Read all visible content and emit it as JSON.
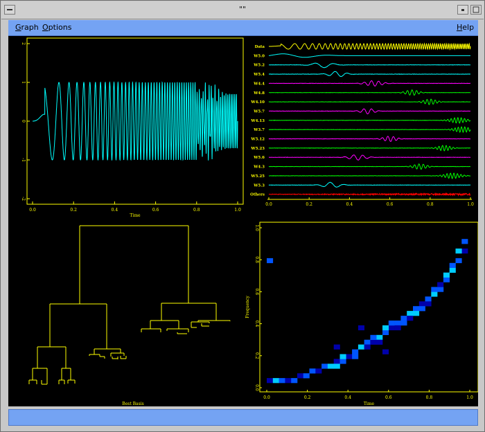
{
  "window": {
    "title": "\"\""
  },
  "menubar": {
    "items": [
      {
        "label": "Graph",
        "mnemonic": "G"
      },
      {
        "label": "Options",
        "mnemonic": "O"
      }
    ],
    "help": {
      "label": "Help",
      "mnemonic": "H"
    }
  },
  "colors": {
    "signal": "#00ffff",
    "axes_primary": "#ffff00",
    "magenta": "#ff00ff",
    "green": "#00ff00",
    "red": "#ff0000",
    "menubar": "#74a3f3"
  },
  "chart_data": [
    {
      "type": "line",
      "xlabel": "Time",
      "ylabel": "",
      "xlim": [
        0,
        1
      ],
      "ylim": [
        -2,
        2
      ],
      "x_ticks": [
        "0.0",
        "0.2",
        "0.4",
        "0.6",
        "0.8",
        "1.0"
      ],
      "y_ticks": [
        "-2",
        "-1",
        "0",
        "1",
        "2"
      ],
      "description_series": "chirp signal"
    },
    {
      "type": "line",
      "xlim": [
        0,
        1
      ],
      "x_ticks": [
        "0.0",
        "0.2",
        "0.4",
        "0.6",
        "0.8",
        "1.0"
      ],
      "rows": [
        {
          "label": "Data",
          "color": "#ffff00",
          "kind": "chirp"
        },
        {
          "label": "W5.0",
          "color": "#00ffff",
          "kind": "low",
          "center": 0.12,
          "width": 0.14,
          "freq": 4
        },
        {
          "label": "W5.2",
          "color": "#00ffff",
          "kind": "packet",
          "center": 0.27,
          "width": 0.06,
          "freq": 10
        },
        {
          "label": "W5.4",
          "color": "#00ffff",
          "kind": "packet",
          "center": 0.34,
          "width": 0.05,
          "freq": 16
        },
        {
          "label": "W4.4",
          "color": "#ff00ff",
          "kind": "packet",
          "center": 0.52,
          "width": 0.05,
          "freq": 28
        },
        {
          "label": "W4.8",
          "color": "#00ff00",
          "kind": "packet",
          "center": 0.71,
          "width": 0.04,
          "freq": 44
        },
        {
          "label": "W4.10",
          "color": "#00ff00",
          "kind": "packet",
          "center": 0.8,
          "width": 0.04,
          "freq": 50
        },
        {
          "label": "W5.7",
          "color": "#ff00ff",
          "kind": "packet",
          "center": 0.49,
          "width": 0.04,
          "freq": 26
        },
        {
          "label": "W4.13",
          "color": "#00ff00",
          "kind": "packet",
          "center": 0.94,
          "width": 0.05,
          "freq": 60
        },
        {
          "label": "W3.7",
          "color": "#00ff00",
          "kind": "packet",
          "center": 0.96,
          "width": 0.05,
          "freq": 62
        },
        {
          "label": "W5.12",
          "color": "#ff00ff",
          "kind": "packet",
          "center": 0.6,
          "width": 0.04,
          "freq": 36
        },
        {
          "label": "W5.23",
          "color": "#00ff00",
          "kind": "packet",
          "center": 0.87,
          "width": 0.04,
          "freq": 56
        },
        {
          "label": "W5.6",
          "color": "#ff00ff",
          "kind": "packet",
          "center": 0.44,
          "width": 0.05,
          "freq": 22
        },
        {
          "label": "W4.3",
          "color": "#00ff00",
          "kind": "packet",
          "center": 0.75,
          "width": 0.04,
          "freq": 46
        },
        {
          "label": "W5.25",
          "color": "#00ff00",
          "kind": "packet",
          "center": 0.91,
          "width": 0.05,
          "freq": 58
        },
        {
          "label": "W5.3",
          "color": "#00ffff",
          "kind": "packet",
          "center": 0.31,
          "width": 0.05,
          "freq": 14
        },
        {
          "label": "Others",
          "color": "#ff0000",
          "kind": "noise"
        }
      ]
    },
    {
      "type": "dendrogram",
      "xlabel": "Best Basis",
      "color": "#ffff00"
    },
    {
      "type": "heatmap",
      "xlabel": "Time",
      "ylabel": "Frequency",
      "xlim": [
        0,
        1
      ],
      "ylim": [
        0,
        1
      ],
      "x_ticks": [
        "0.0",
        "0.2",
        "0.4",
        "0.6",
        "0.8",
        "1.0"
      ],
      "y_ticks": [
        "0.0",
        "0.2",
        "0.4",
        "0.6",
        "0.8",
        "1.0"
      ],
      "cells": [
        [
          0.0,
          0.03,
          0.03,
          0.03,
          1
        ],
        [
          0.03,
          0.03,
          0.06,
          0.03,
          3
        ],
        [
          0.06,
          0.03,
          0.09,
          0.03,
          2
        ],
        [
          0.09,
          0.03,
          0.12,
          0.03,
          1
        ],
        [
          0.12,
          0.03,
          0.15,
          0.06,
          2
        ],
        [
          0.15,
          0.06,
          0.18,
          0.06,
          1
        ],
        [
          0.18,
          0.06,
          0.21,
          0.06,
          2
        ],
        [
          0.21,
          0.09,
          0.24,
          0.09,
          2
        ],
        [
          0.24,
          0.09,
          0.27,
          0.12,
          1
        ],
        [
          0.27,
          0.12,
          0.3,
          0.12,
          2
        ],
        [
          0.3,
          0.12,
          0.33,
          0.15,
          3
        ],
        [
          0.33,
          0.15,
          0.36,
          0.15,
          1
        ],
        [
          0.36,
          0.15,
          0.39,
          0.18,
          2
        ],
        [
          0.39,
          0.18,
          0.42,
          0.18,
          1
        ],
        [
          0.42,
          0.21,
          0.45,
          0.21,
          2
        ],
        [
          0.45,
          0.24,
          0.48,
          0.24,
          3
        ],
        [
          0.48,
          0.27,
          0.51,
          0.27,
          2
        ],
        [
          0.51,
          0.27,
          0.54,
          0.3,
          1
        ],
        [
          0.54,
          0.3,
          0.57,
          0.33,
          3
        ],
        [
          0.57,
          0.33,
          0.6,
          0.36,
          2
        ],
        [
          0.6,
          0.36,
          0.63,
          0.36,
          1
        ],
        [
          0.63,
          0.39,
          0.66,
          0.39,
          2
        ],
        [
          0.66,
          0.42,
          0.69,
          0.42,
          2
        ],
        [
          0.69,
          0.45,
          0.72,
          0.45,
          3
        ],
        [
          0.72,
          0.48,
          0.75,
          0.51,
          2
        ],
        [
          0.75,
          0.51,
          0.78,
          0.54,
          1
        ],
        [
          0.78,
          0.54,
          0.81,
          0.57,
          2
        ],
        [
          0.81,
          0.57,
          0.84,
          0.6,
          3
        ],
        [
          0.84,
          0.6,
          0.87,
          0.63,
          2
        ],
        [
          0.87,
          0.66,
          0.9,
          0.69,
          2
        ],
        [
          0.9,
          0.72,
          0.93,
          0.75,
          3
        ],
        [
          0.93,
          0.78,
          0.96,
          0.81,
          2
        ],
        [
          0.96,
          0.84,
          0.99,
          0.87,
          1
        ],
        [
          0.33,
          0.12,
          0.36,
          0.12,
          3
        ],
        [
          0.36,
          0.18,
          0.39,
          0.15,
          3
        ],
        [
          0.42,
          0.18,
          0.45,
          0.24,
          2
        ],
        [
          0.48,
          0.24,
          0.51,
          0.3,
          1
        ],
        [
          0.51,
          0.3,
          0.54,
          0.33,
          2
        ],
        [
          0.54,
          0.27,
          0.57,
          0.3,
          1
        ],
        [
          0.57,
          0.36,
          0.6,
          0.39,
          3
        ],
        [
          0.6,
          0.39,
          0.63,
          0.42,
          2
        ],
        [
          0.63,
          0.36,
          0.66,
          0.45,
          1
        ],
        [
          0.66,
          0.39,
          0.69,
          0.48,
          2
        ],
        [
          0.69,
          0.42,
          0.72,
          0.51,
          1
        ],
        [
          0.72,
          0.45,
          0.75,
          0.48,
          3
        ],
        [
          0.75,
          0.48,
          0.78,
          0.51,
          2
        ],
        [
          0.78,
          0.51,
          0.81,
          0.54,
          1
        ],
        [
          0.81,
          0.6,
          0.84,
          0.63,
          2
        ],
        [
          0.84,
          0.63,
          0.87,
          0.66,
          1
        ],
        [
          0.87,
          0.69,
          0.9,
          0.72,
          3
        ],
        [
          0.9,
          0.75,
          0.93,
          0.78,
          2
        ],
        [
          0.93,
          0.84,
          0.96,
          0.87,
          3
        ],
        [
          0.96,
          0.9,
          0.99,
          0.93,
          2
        ],
        [
          0.0,
          0.78,
          0.03,
          0.81,
          2
        ],
        [
          0.33,
          0.24,
          0.36,
          0.27,
          1
        ],
        [
          0.45,
          0.36,
          0.48,
          0.39,
          1
        ],
        [
          0.57,
          0.21,
          0.6,
          0.24,
          1
        ]
      ]
    }
  ]
}
